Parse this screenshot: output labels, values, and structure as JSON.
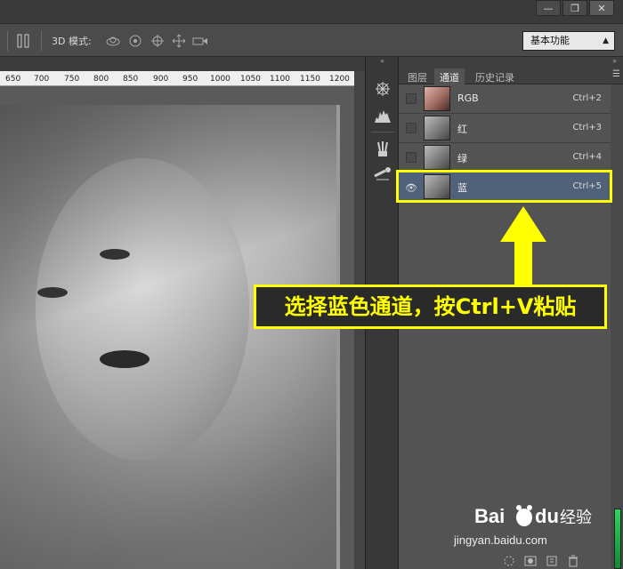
{
  "options_bar": {
    "mode_label": "3D 模式:",
    "workspace_value": "基本功能"
  },
  "ruler": {
    "ticks": [
      "650",
      "700",
      "750",
      "800",
      "850",
      "900",
      "950",
      "1000",
      "1050",
      "1100",
      "1150",
      "1200"
    ]
  },
  "panel": {
    "tabs": [
      {
        "label": "图层",
        "active": false
      },
      {
        "label": "通道",
        "active": true
      },
      {
        "label": "历史记录",
        "active": false
      }
    ],
    "channels": [
      {
        "name": "RGB",
        "shortcut": "Ctrl+2",
        "visible": false,
        "selected": false
      },
      {
        "name": "红",
        "shortcut": "Ctrl+3",
        "visible": false,
        "selected": false
      },
      {
        "name": "绿",
        "shortcut": "Ctrl+4",
        "visible": false,
        "selected": false
      },
      {
        "name": "蓝",
        "shortcut": "Ctrl+5",
        "visible": true,
        "selected": true
      }
    ]
  },
  "annotation": {
    "text": "选择蓝色通道，按Ctrl+V粘贴",
    "color": "#ffff00"
  },
  "watermark": {
    "brand": "Bai du 经验",
    "url": "jingyan.baidu.com"
  },
  "colors": {
    "selected_row": "#50627a",
    "highlight": "#ffff00"
  }
}
